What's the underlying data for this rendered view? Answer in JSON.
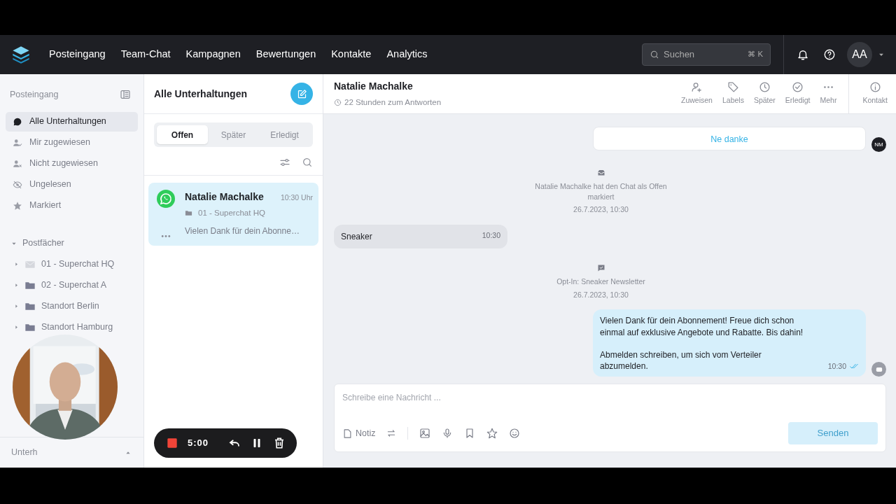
{
  "nav": {
    "items": [
      {
        "label": "Posteingang"
      },
      {
        "label": "Team-Chat"
      },
      {
        "label": "Kampagnen"
      },
      {
        "label": "Bewertungen"
      },
      {
        "label": "Kontakte"
      },
      {
        "label": "Analytics"
      }
    ],
    "search": {
      "placeholder": "Suchen",
      "shortcut": "⌘ K"
    },
    "user": {
      "initials": "AA"
    }
  },
  "sidebar": {
    "title": "Posteingang",
    "items": [
      {
        "label": "Alle Unterhaltungen",
        "kind": "chat",
        "selected": true
      },
      {
        "label": "Mir zugewiesen",
        "kind": "assigned",
        "selected": false
      },
      {
        "label": "Nicht zugewiesen",
        "kind": "unassigned",
        "selected": false
      },
      {
        "label": "Ungelesen",
        "kind": "unread",
        "selected": false
      },
      {
        "label": "Markiert",
        "kind": "star",
        "selected": false
      }
    ],
    "section": {
      "label": "Postfächer",
      "expanded": true,
      "children": [
        {
          "label": "01 - Superchat HQ",
          "kind": "mail"
        },
        {
          "label": "02 - Superchat A",
          "kind": "folder"
        },
        {
          "label": "Standort Berlin",
          "kind": "folder"
        },
        {
          "label": "Standort Hamburg",
          "kind": "folder"
        }
      ]
    },
    "footer": "Unterh"
  },
  "conversations": {
    "title": "Alle Unterhaltungen",
    "tabs": [
      {
        "label": "Offen",
        "selected": true
      },
      {
        "label": "Später",
        "selected": false
      },
      {
        "label": "Erledigt",
        "selected": false
      }
    ],
    "items": [
      {
        "name": "Natalie Machalke",
        "time": "10:30 Uhr",
        "inbox": "01 - Superchat HQ",
        "preview": "Vielen Dank für dein Abonne…",
        "selected": true
      }
    ]
  },
  "chat": {
    "contact": "Natalie Machalke",
    "subtitle": "22 Stunden zum Antworten",
    "actions": [
      {
        "label": "Zuweisen",
        "kind": "assign"
      },
      {
        "label": "Labels",
        "kind": "tag"
      },
      {
        "label": "Später",
        "kind": "snooze"
      },
      {
        "label": "Erledigt",
        "kind": "done"
      },
      {
        "label": "Mehr",
        "kind": "more"
      }
    ],
    "contact_button": "Kontakt",
    "messages": [
      {
        "kind": "button",
        "text": "Ne danke",
        "avatar": "NM"
      },
      {
        "kind": "status_event",
        "text": "Natalie Machalke hat den Chat als Offen markiert",
        "time": "26.7.2023, 10:30"
      },
      {
        "kind": "incoming",
        "text": "Sneaker",
        "time": "10:30"
      },
      {
        "kind": "optin_event",
        "text": "Opt-In: Sneaker Newsletter",
        "time": "26.7.2023, 10:30"
      },
      {
        "kind": "outgoing",
        "paragraphs": [
          "Vielen Dank für dein Abonnement! Freue dich schon einmal auf exklusive Angebote und Rabatte. Bis dahin!",
          "Abmelden schreiben, um sich vom Verteiler abzumelden."
        ],
        "time": "10:30",
        "read": true
      }
    ]
  },
  "composer": {
    "placeholder": "Schreibe eine Nachricht ...",
    "note": "Notiz",
    "send": "Senden",
    "send_disabled": true
  },
  "recorder": {
    "time": "5:00"
  }
}
